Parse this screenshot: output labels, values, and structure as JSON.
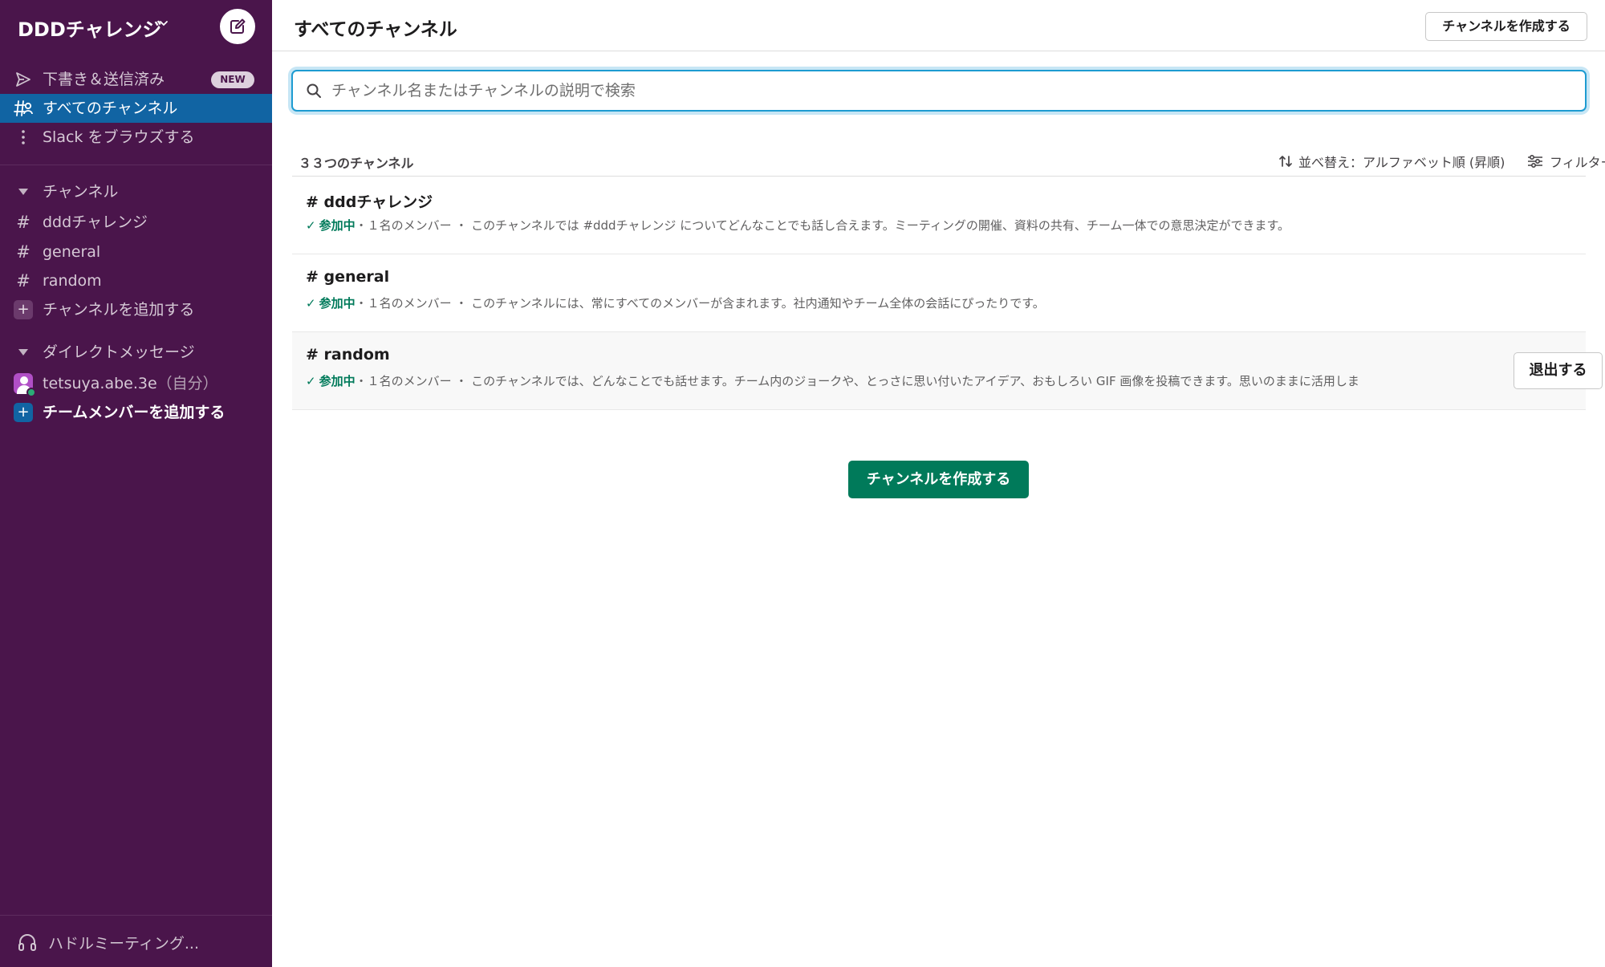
{
  "workspace": {
    "name": "DDDチャレンジ"
  },
  "sidebar": {
    "drafts": {
      "label": "下書き＆送信済み",
      "badge": "NEW"
    },
    "all_channels": {
      "label": "すべてのチャンネル"
    },
    "browse": {
      "label": "Slack をブラウズする"
    },
    "channels_section": {
      "title": "チャンネル",
      "items": [
        {
          "name": "dddチャレンジ"
        },
        {
          "name": "general"
        },
        {
          "name": "random"
        }
      ],
      "add_label": "チャンネルを追加する"
    },
    "dm_section": {
      "title": "ダイレクトメッセージ",
      "self": {
        "name": "tetsuya.abe.3e",
        "suffix": "（自分）"
      },
      "add_label": "チームメンバーを追加する"
    },
    "huddle": {
      "label": "ハドルミーティング..."
    }
  },
  "main": {
    "title": "すべてのチャンネル",
    "create_button": "チャンネルを作成する",
    "search": {
      "placeholder": "チャンネル名またはチャンネルの説明で検索",
      "value": ""
    },
    "count_label": "３３つのチャンネル",
    "sort_label": "並べ替え：アルファベット順 (昇順)",
    "filter_label": "フィルター",
    "channels": [
      {
        "name": "# dddチャレンジ",
        "check": "✓",
        "status": "参加中",
        "meta": "・１名のメンバー ・ このチャンネルでは #dddチャレンジ についてどんなことでも話し合えます。ミーティングの開催、資料の共有、チーム一体での意思決定ができます。"
      },
      {
        "name": "# general",
        "check": "✓",
        "status": "参加中",
        "meta": "・１名のメンバー ・ このチャンネルには、常にすべてのメンバーが含まれます。社内通知やチーム全体の会話にぴったりです。"
      },
      {
        "name": "# random",
        "check": "✓",
        "status": "参加中",
        "meta": "・１名のメンバー ・ このチャンネルでは、どんなことでも話せます。チーム内のジョークや、とっさに思い付いたアイデア、おもしろい GIF 画像を投稿できます。思いのままに活用しま",
        "leave_button": "退出する"
      }
    ],
    "create_center_button": "チャンネルを作成する"
  },
  "colors": {
    "sidebar_bg": "#4a154b",
    "active_item": "#1164a3",
    "accent_green": "#007a5a",
    "search_focus": "#1d9bd1"
  }
}
